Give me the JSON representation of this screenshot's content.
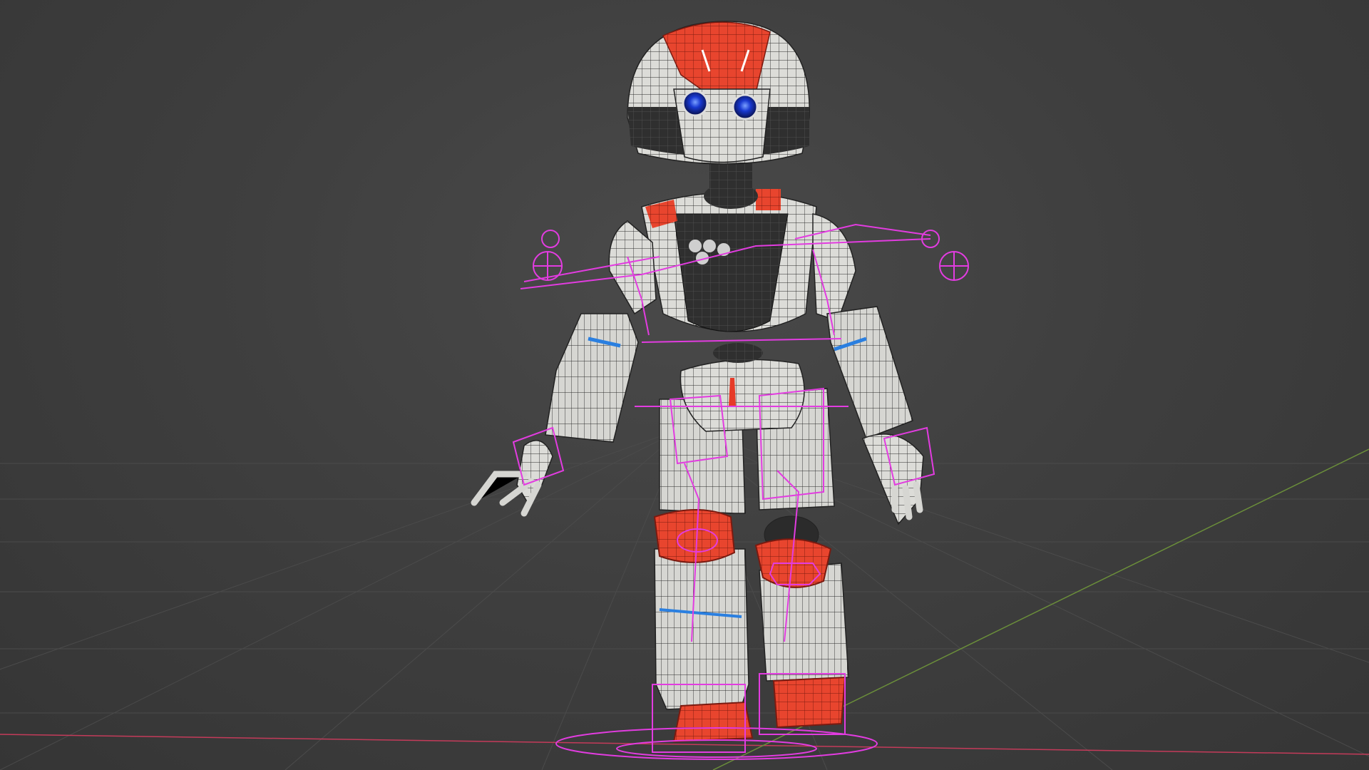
{
  "viewport": {
    "background_color": "#3f3f3f",
    "grid_color": "#4a4a4a",
    "x_axis_color": "#c43b5a",
    "y_axis_color": "#6b8f3a"
  },
  "model": {
    "name_visible": false,
    "body_color": "#d9d9d6",
    "accent_color": "#e63b28",
    "dark_color": "#2b2b2b",
    "eye_color": "#1a3bd8",
    "stripe_color": "#2a7fe0",
    "wireframe_color": "#1e1e1e",
    "rig_color": "#e23ce0"
  }
}
